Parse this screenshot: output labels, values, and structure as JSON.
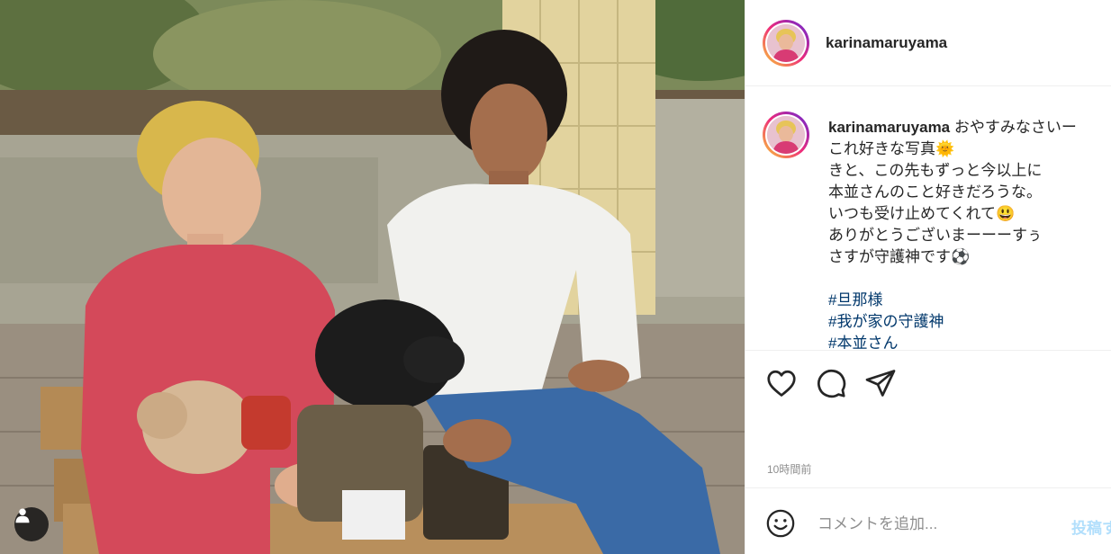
{
  "post": {
    "username": "karinamaruyama",
    "caption": {
      "lines": [
        "おやすみなさいー",
        "これ好きな写真🌞",
        "きと、この先もずっと今以上に",
        "本並さんのこと好きだろうな。",
        "いつも受け止めてくれて😃",
        "ありがとうございまーーーすぅ",
        "さすが守護神です⚽"
      ],
      "hashtags": [
        "#旦那様",
        "#我が家の守護神",
        "#本並さん"
      ]
    },
    "timestamp": "10時間前"
  },
  "icons": {
    "like": "heart-icon",
    "comment": "comment-icon",
    "share": "paper-plane-icon",
    "emoji": "smiley-icon",
    "user_tag": "user-icon"
  },
  "comment_box": {
    "placeholder": "コメントを追加...",
    "post_label": "投稿する"
  },
  "colors": {
    "username": "#262626",
    "hashtag": "#00376b",
    "timestamp": "#8e8e8e",
    "post_button": "#b2dffc",
    "border": "#efefef"
  }
}
